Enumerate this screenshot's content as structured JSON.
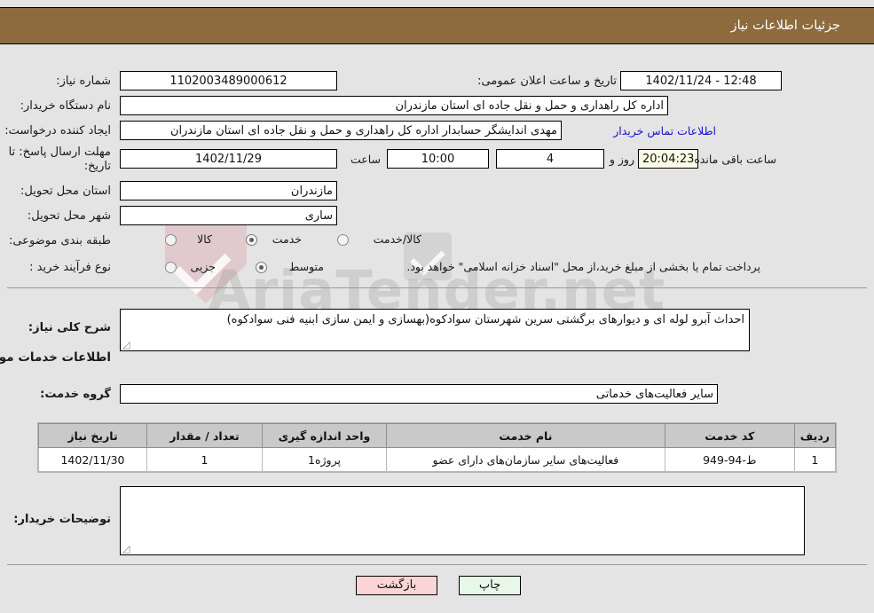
{
  "header": {
    "title": "جزئیات اطلاعات نیاز"
  },
  "watermark": {
    "text": "AriaTender.net"
  },
  "form": {
    "need_number": {
      "label": "شماره نیاز:",
      "value": "1102003489000612"
    },
    "announce_datetime": {
      "label": "تاریخ و ساعت اعلان عمومی:",
      "value": "1402/11/24 - 12:48"
    },
    "buyer_org": {
      "label": "نام دستگاه خریدار:",
      "value": "اداره کل راهداری و حمل و نقل جاده ای استان مازندران"
    },
    "requester": {
      "label": "ایجاد کننده درخواست:",
      "value": "مهدی اندایشگر حسابدار اداره کل راهداری و حمل و نقل جاده ای استان مازندران",
      "contact_link": "اطلاعات تماس خریدار"
    },
    "deadline": {
      "label": "مهلت ارسال پاسخ: تا تاریخ:",
      "date": "1402/11/29",
      "hour_label": "ساعت",
      "hour": "10:00",
      "days": "4",
      "days_label": "روز و",
      "countdown": "20:04:23",
      "remaining_label": "ساعت باقی مانده"
    },
    "delivery_province": {
      "label": "استان محل تحویل:",
      "value": "مازندران"
    },
    "delivery_city": {
      "label": "شهر محل تحویل:",
      "value": "ساری"
    },
    "subject_class": {
      "label": "طبقه بندی موضوعی:",
      "options": [
        {
          "label": "کالا",
          "selected": false
        },
        {
          "label": "خدمت",
          "selected": true
        },
        {
          "label": "کالا/خدمت",
          "selected": false
        }
      ]
    },
    "purchase_type": {
      "label": "نوع فرآیند خرید :",
      "options": [
        {
          "label": "جزیی",
          "selected": false
        },
        {
          "label": "متوسط",
          "selected": true
        }
      ],
      "note": "پرداخت تمام یا بخشی از مبلغ خرید،از محل \"اسناد خزانه اسلامی\" خواهد بود."
    },
    "general_description": {
      "label": "شرح کلی نیاز:",
      "value": "احداث آبرو لوله ای و دیوارهای برگشتی سرین شهرستان سوادکوه(بهسازی و ایمن سازی ابنیه فنی سوادکوه)"
    },
    "services_section_title": "اطلاعات خدمات مورد نیاز",
    "service_group": {
      "label": "گروه خدمت:",
      "value": "سایر فعالیت‌های خدماتی"
    },
    "buyer_notes": {
      "label": "توضیحات خریدار:",
      "value": ""
    }
  },
  "table": {
    "columns": [
      "ردیف",
      "کد خدمت",
      "نام خدمت",
      "واحد اندازه گیری",
      "تعداد / مقدار",
      "تاریخ نیاز"
    ],
    "rows": [
      {
        "index": "1",
        "service_code": "ط-94-949",
        "service_name": "فعالیت‌های سایر سازمان‌های دارای عضو",
        "unit": "پروژه1",
        "quantity": "1",
        "need_date": "1402/11/30"
      }
    ]
  },
  "footer": {
    "print_label": "چاپ",
    "back_label": "بازگشت"
  },
  "colors": {
    "header_bg": "#8d6b3f",
    "page_bg": "#e4e4e4",
    "link": "#1414cc",
    "print_btn": "#e8f8e8",
    "back_btn": "#fbd5d5",
    "countdown_bg": "#fbfbe6",
    "table_header_bg": "#c9c9c9"
  }
}
